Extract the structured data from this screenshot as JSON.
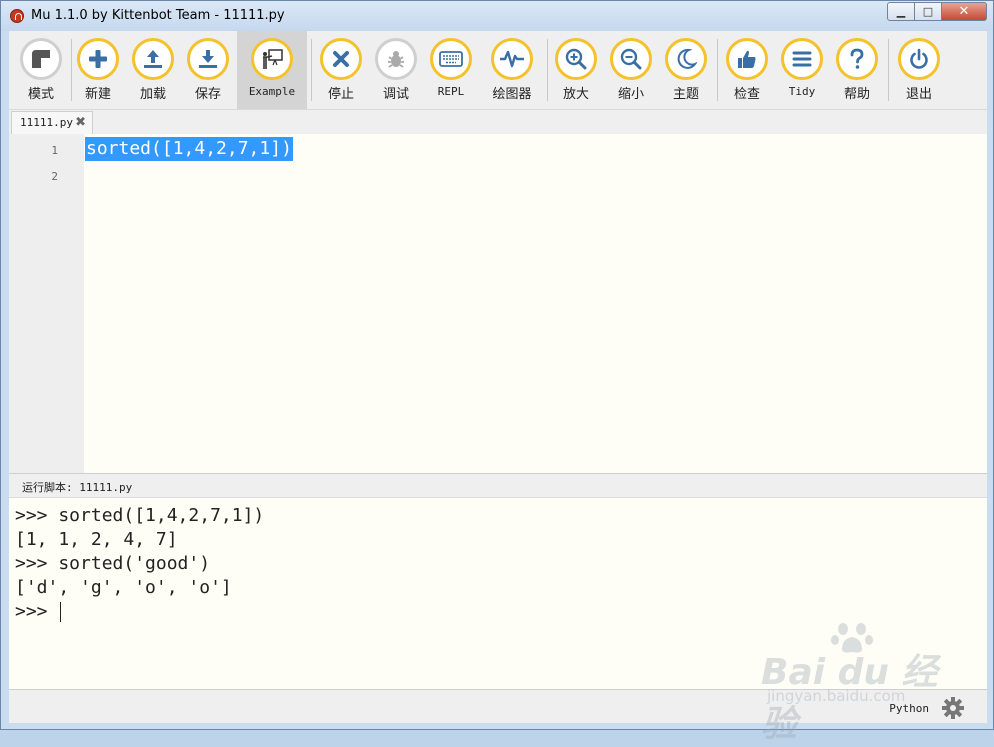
{
  "window": {
    "title": "Mu 1.1.0 by Kittenbot Team - 11111.py",
    "minimize": "▁",
    "maximize": "□",
    "close": "✕"
  },
  "toolbar": {
    "buttons": [
      {
        "id": "mode",
        "label": "模式",
        "icon": "mode-icon"
      },
      {
        "id": "new",
        "label": "新建",
        "icon": "plus-icon"
      },
      {
        "id": "load",
        "label": "加载",
        "icon": "upload-icon"
      },
      {
        "id": "save",
        "label": "保存",
        "icon": "download-icon"
      },
      {
        "id": "example",
        "label": "Example",
        "icon": "teacher-board-icon"
      },
      {
        "id": "stop",
        "label": "停止",
        "icon": "x-icon"
      },
      {
        "id": "debug",
        "label": "调试",
        "icon": "bug-icon"
      },
      {
        "id": "repl",
        "label": "REPL",
        "icon": "keyboard-icon"
      },
      {
        "id": "plotter",
        "label": "绘图器",
        "icon": "pulse-icon"
      },
      {
        "id": "zoom_in",
        "label": "放大",
        "icon": "zoom-in-icon"
      },
      {
        "id": "zoom_out",
        "label": "缩小",
        "icon": "zoom-out-icon"
      },
      {
        "id": "theme",
        "label": "主题",
        "icon": "moon-icon"
      },
      {
        "id": "check",
        "label": "检查",
        "icon": "thumbs-up-icon"
      },
      {
        "id": "tidy",
        "label": "Tidy",
        "icon": "lines-icon"
      },
      {
        "id": "help",
        "label": "帮助",
        "icon": "question-icon"
      },
      {
        "id": "quit",
        "label": "退出",
        "icon": "power-icon"
      }
    ],
    "active": "example",
    "accent_color": "#f4c22c",
    "icon_color": "#3a6fa5"
  },
  "tabs": [
    {
      "name": "11111.py",
      "close": "✖"
    }
  ],
  "editor": {
    "line_numbers": [
      "1",
      "2"
    ],
    "lines": [
      "sorted([1,4,2,7,1])",
      ""
    ],
    "selection_color": "#3399ff",
    "background": "#fefef7"
  },
  "repl": {
    "title": "运行脚本: 11111.py",
    "lines": [
      ">>> sorted([1,4,2,7,1])",
      "[1, 1, 2, 4, 7]",
      ">>> sorted('good')",
      "['d', 'g', 'o', 'o']",
      ">>> "
    ]
  },
  "status": {
    "mode": "Python",
    "settings_icon": "gear-icon"
  },
  "watermark": {
    "brand": "Bai du 经验",
    "url": "jingyan.baidu.com"
  }
}
